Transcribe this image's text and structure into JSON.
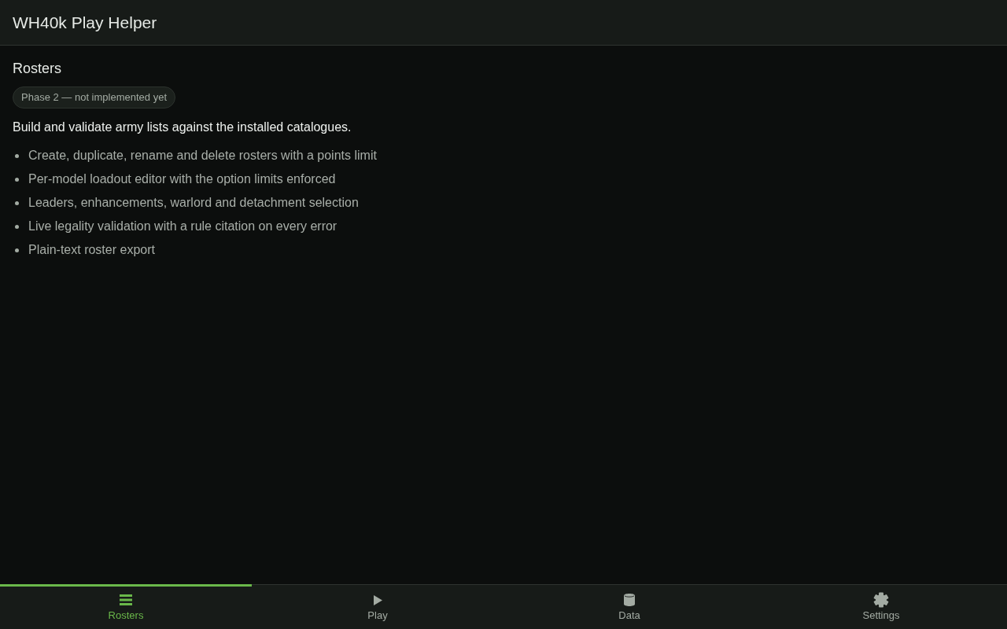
{
  "app_bar": {
    "title": "WH40k Play Helper"
  },
  "page": {
    "heading": "Rosters",
    "badge": "Phase 2 — not implemented yet",
    "intro": "Build and validate army lists against the installed catalogues.",
    "features": [
      "Create, duplicate, rename and delete rosters with a points limit",
      "Per-model loadout editor with the option limits enforced",
      "Leaders, enhancements, warlord and detachment selection",
      "Live legality validation with a rule citation on every error",
      "Plain-text roster export"
    ]
  },
  "nav": [
    {
      "label": "Rosters",
      "selected": true
    },
    {
      "label": "Play",
      "selected": false
    },
    {
      "label": "Data",
      "selected": false
    },
    {
      "label": "Settings",
      "selected": false
    }
  ]
}
